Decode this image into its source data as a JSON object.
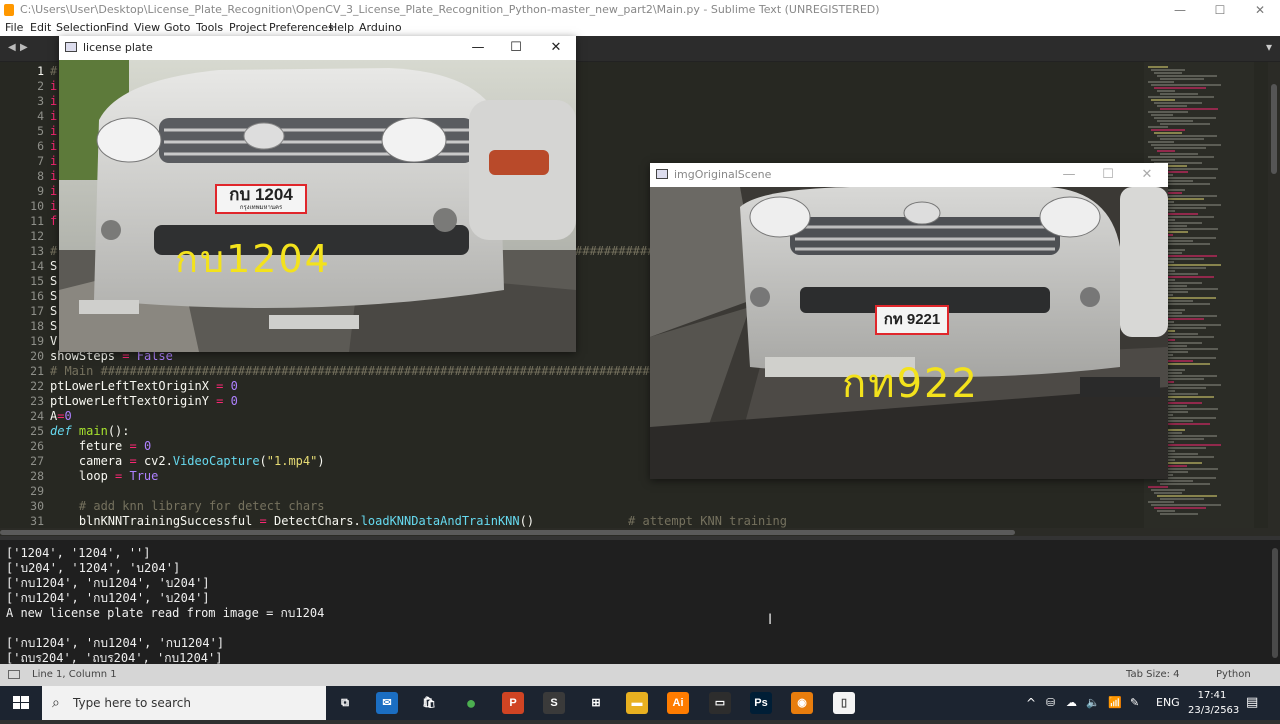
{
  "window": {
    "title": "C:\\Users\\User\\Desktop\\License_Plate_Recognition\\OpenCV_3_License_Plate_Recognition_Python-master_new_part2\\Main.py - Sublime Text (UNREGISTERED)",
    "minimize": "—",
    "maximize": "☐",
    "close": "✕"
  },
  "menu": [
    "File",
    "Edit",
    "Selection",
    "Find",
    "View",
    "Goto",
    "Tools",
    "Project",
    "Preferences",
    "Help",
    "Arduino"
  ],
  "tabs": {
    "prev": "◀",
    "next": "▶",
    "dropdown": "▾"
  },
  "editor": {
    "line_numbers": [
      "1",
      "2",
      "3",
      "4",
      "5",
      "6",
      "7",
      "8",
      "9",
      "10",
      "11",
      "12",
      "13",
      "14",
      "15",
      "16",
      "17",
      "18",
      "19",
      "20",
      "21",
      "22",
      "23",
      "24",
      "25",
      "26",
      "27",
      "28",
      "29",
      "30",
      "31"
    ],
    "hidden_prefix": [
      "#",
      "i",
      "i",
      "i",
      "i",
      "i",
      "i",
      "i",
      "i",
      "i",
      "f",
      "",
      "#",
      "S",
      "S",
      "S",
      "S",
      "S",
      "V"
    ],
    "line13_tail": "########################################",
    "line20": {
      "name": "showSteps",
      "op": " = ",
      "val": "False"
    },
    "line21": "# Main ##################################################################################",
    "line22": {
      "name": "ptLowerLeftTextOriginX",
      "op": " = ",
      "val": "0"
    },
    "line23": {
      "name": "ptLowerLeftTextOriginY",
      "op": " = ",
      "val": "0"
    },
    "line24": {
      "name": "A",
      "op": "=",
      "val": "0"
    },
    "line25": {
      "kw": "def",
      "name": "main",
      "rest": "():"
    },
    "line26": {
      "name": "    feture",
      "op": " = ",
      "val": "0"
    },
    "line27": {
      "name": "    camera",
      "op": " = ",
      "pre": "cv2.",
      "fn": "VideoCapture",
      "open": "(",
      "str": "\"1.mp4\"",
      "close": ")"
    },
    "line28": {
      "name": "    loop",
      "op": " = ",
      "val": "True"
    },
    "line29": "",
    "line30": "    # add knn library for detect chars",
    "line31": {
      "name": "    blnKNNTrainingSuccessful",
      "op": " = ",
      "pre": "DetectChars.",
      "fn": "loadKNNDataAndTrainKNN",
      "rest": "()",
      "cm": "             # attempt KNN training"
    }
  },
  "license_window": {
    "title": "license plate",
    "plate_text": "กบ 1204",
    "sub_text": "กรุงเทพมหานคร",
    "ocr_text": "กบ1204"
  },
  "scene_window": {
    "title": "imgOriginalScene",
    "plate_text": "กท 9221",
    "ocr_text": "กท922"
  },
  "console": {
    "lines": [
      "['1204', '1204', '']",
      "['บ204', '1204', 'บ204']",
      "['กบ1204', 'กบ1204', 'บ204']",
      "['กบ1204', 'กบ1204', 'บ204']",
      "A new license plate read from image = กบ1204",
      "",
      "['กบ1204', 'กบ1204', 'กบ1204']",
      "['ถบร204', 'ถบร204', 'กบ1204']"
    ]
  },
  "status": {
    "position": "Line 1, Column 1",
    "tab_size": "Tab Size: 4",
    "syntax": "Python"
  },
  "taskbar": {
    "search_placeholder": "Type here to search",
    "apps": [
      {
        "name": "task-view",
        "glyph": "⧉",
        "color": "#1c2430"
      },
      {
        "name": "mail",
        "glyph": "✉",
        "color": "#1b6ec2"
      },
      {
        "name": "store",
        "glyph": "🛍",
        "color": "#1c2430"
      },
      {
        "name": "chrome",
        "glyph": "●",
        "color": "#1c2430"
      },
      {
        "name": "powerpoint",
        "glyph": "P",
        "color": "#d04423"
      },
      {
        "name": "sublime",
        "glyph": "S",
        "color": "#3a3a3a"
      },
      {
        "name": "network",
        "glyph": "⊞",
        "color": "#1c2430"
      },
      {
        "name": "explorer",
        "glyph": "▬",
        "color": "#e8b020"
      },
      {
        "name": "illustrator",
        "glyph": "Ai",
        "color": "#ff7c00"
      },
      {
        "name": "terminal",
        "glyph": "▭",
        "color": "#2d2d2d"
      },
      {
        "name": "photoshop",
        "glyph": "Ps",
        "color": "#001e36"
      },
      {
        "name": "blender",
        "glyph": "◉",
        "color": "#e87d0d"
      },
      {
        "name": "notepad",
        "glyph": "▯",
        "color": "#f4f4f4"
      }
    ],
    "tray_lang": "ENG",
    "time": "17:41",
    "date": "23/3/2563"
  }
}
